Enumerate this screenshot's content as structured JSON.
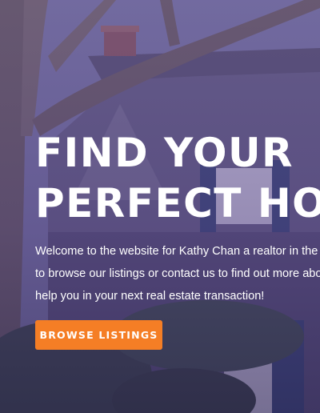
{
  "hero": {
    "headline_line1": "FIND YOUR",
    "headline_line2": "PERFECT HOME",
    "intro_text": "Welcome to the website for Kathy Chan a realtor in the area. Feel free to browse our listings or contact us to find out more about how we can help you in your next real estate transaction!",
    "cta_label": "BROWSE LISTINGS",
    "background_image": "house-with-tree-photo"
  },
  "colors": {
    "overlay": "#5a468c",
    "cta": "#f57e25",
    "text": "#ffffff"
  }
}
